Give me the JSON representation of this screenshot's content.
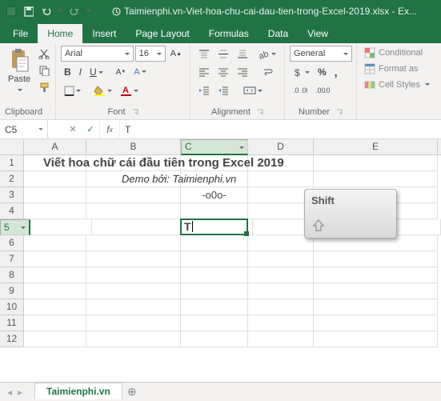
{
  "title": "Taimienphi.vn-Viet-hoa-chu-cai-dau-tien-trong-Excel-2019.xlsx - Ex...",
  "tabs": {
    "file": "File",
    "home": "Home",
    "insert": "Insert",
    "pagelayout": "Page Layout",
    "formulas": "Formulas",
    "data": "Data",
    "view": "View"
  },
  "ribbon": {
    "clipboard": {
      "paste": "Paste",
      "label": "Clipboard"
    },
    "font": {
      "name": "Arial",
      "size": "16",
      "label": "Font"
    },
    "alignment": {
      "label": "Alignment"
    },
    "number": {
      "format": "General",
      "label": "Number"
    },
    "styles": {
      "cond": "Conditional",
      "fmt": "Format as",
      "cell": "Cell Styles"
    }
  },
  "namebox": "C5",
  "formula": "T",
  "columns": [
    "A",
    "B",
    "C",
    "D",
    "E"
  ],
  "rownums": [
    "1",
    "2",
    "3",
    "4",
    "5",
    "6",
    "7",
    "8",
    "9",
    "10",
    "11",
    "12"
  ],
  "cells": {
    "r1": "Viết hoa chữ cái đầu tiên trong Excel 2019",
    "r2": "Demo bởi: Taimienphi.vn",
    "r3": "-o0o-",
    "c5": "T"
  },
  "shiftkey": "Shift",
  "sheet": "Taimienphi.vn"
}
